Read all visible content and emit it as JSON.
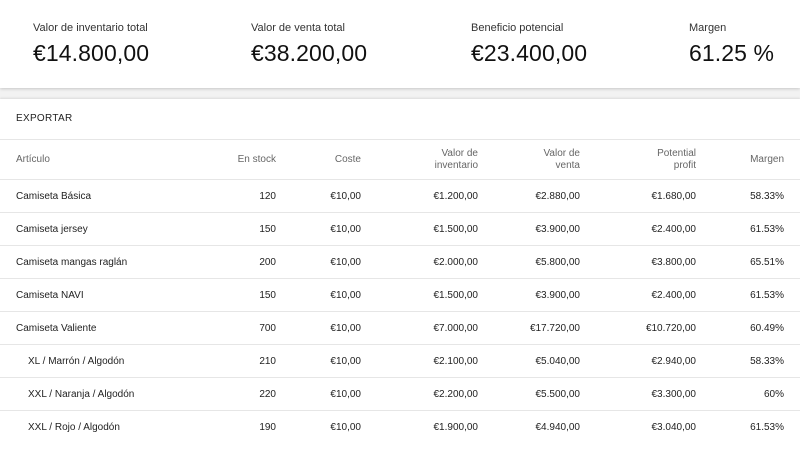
{
  "summary": {
    "inventory_label": "Valor de inventario total",
    "inventory_value": "€14.800,00",
    "sale_label": "Valor de venta total",
    "sale_value": "€38.200,00",
    "profit_label": "Beneficio potencial",
    "profit_value": "€23.400,00",
    "margin_label": "Margen",
    "margin_value": "61.25 %"
  },
  "toolbar": {
    "export_label": "EXPORTAR"
  },
  "table": {
    "headers": {
      "article": "Artículo",
      "stock": "En stock",
      "cost": "Coste",
      "inventory_l1": "Valor de",
      "inventory_l2": "inventario",
      "sale_l1": "Valor de",
      "sale_l2": "venta",
      "profit_l1": "Potential",
      "profit_l2": "profit",
      "margin": "Margen"
    },
    "rows": [
      {
        "name": "Camiseta Básica",
        "stock": "120",
        "cost": "€10,00",
        "inventory": "€1.200,00",
        "sale": "€2.880,00",
        "profit": "€1.680,00",
        "margin": "58.33%"
      },
      {
        "name": "Camiseta jersey",
        "stock": "150",
        "cost": "€10,00",
        "inventory": "€1.500,00",
        "sale": "€3.900,00",
        "profit": "€2.400,00",
        "margin": "61.53%"
      },
      {
        "name": "Camiseta mangas raglán",
        "stock": "200",
        "cost": "€10,00",
        "inventory": "€2.000,00",
        "sale": "€5.800,00",
        "profit": "€3.800,00",
        "margin": "65.51%"
      },
      {
        "name": "Camiseta NAVI",
        "stock": "150",
        "cost": "€10,00",
        "inventory": "€1.500,00",
        "sale": "€3.900,00",
        "profit": "€2.400,00",
        "margin": "61.53%"
      },
      {
        "name": "Camiseta Valiente",
        "stock": "700",
        "cost": "€10,00",
        "inventory": "€7.000,00",
        "sale": "€17.720,00",
        "profit": "€10.720,00",
        "margin": "60.49%"
      },
      {
        "name": "XL / Marrón / Algodón",
        "stock": "210",
        "cost": "€10,00",
        "inventory": "€2.100,00",
        "sale": "€5.040,00",
        "profit": "€2.940,00",
        "margin": "58.33%"
      },
      {
        "name": "XXL / Naranja / Algodón",
        "stock": "220",
        "cost": "€10,00",
        "inventory": "€2.200,00",
        "sale": "€5.500,00",
        "profit": "€3.300,00",
        "margin": "60%"
      },
      {
        "name": "XXL / Rojo / Algodón",
        "stock": "190",
        "cost": "€10,00",
        "inventory": "€1.900,00",
        "sale": "€4.940,00",
        "profit": "€3.040,00",
        "margin": "61.53%"
      }
    ]
  }
}
